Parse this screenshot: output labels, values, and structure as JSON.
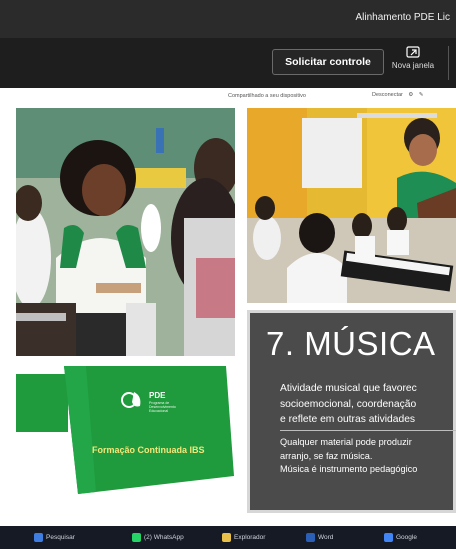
{
  "window": {
    "title": "Alinhamento PDE Lic"
  },
  "toolbar": {
    "request_control_label": "Solicitar controle",
    "new_window_label": "Nova janela",
    "new_window_icon": "new-window-icon"
  },
  "share_bar": {
    "label": "Compartilhado a seu dispositivo",
    "stop_label": "Desconectar",
    "actions_icons": [
      "settings-icon",
      "pen-icon"
    ]
  },
  "slide": {
    "heading": "7. MÚSICA",
    "paragraph1": [
      "Atividade musical que favorec",
      "socioemocional, coordenação",
      "e reflete em outras atividades"
    ],
    "paragraph2": [
      "Qualquer material pode produzir",
      "arranjo, se faz música.",
      "Música é instrumento pedagógico"
    ],
    "brand": {
      "logo_text": "PDE",
      "logo_subtext": "Programa de Desenvolvimento Educacional",
      "course": "Formação Continuada IBS"
    }
  },
  "colors": {
    "titlebar": "#2b2b2b",
    "toolbar": "#1e1e1e",
    "panel": "#4b4b4b",
    "brand_green": "#1f9a3d",
    "course_text": "#f4e77a",
    "taskbar": "#161a24"
  },
  "taskbar": {
    "items": [
      {
        "label": "Pesquisar",
        "color": "#3f7de0"
      },
      {
        "label": "(2) WhatsApp",
        "color": "#25d366"
      },
      {
        "label": "Explorador",
        "color": "#e8c04a"
      },
      {
        "label": "Word",
        "color": "#2b5fb5"
      },
      {
        "label": "Google",
        "color": "#4285f4"
      }
    ]
  }
}
